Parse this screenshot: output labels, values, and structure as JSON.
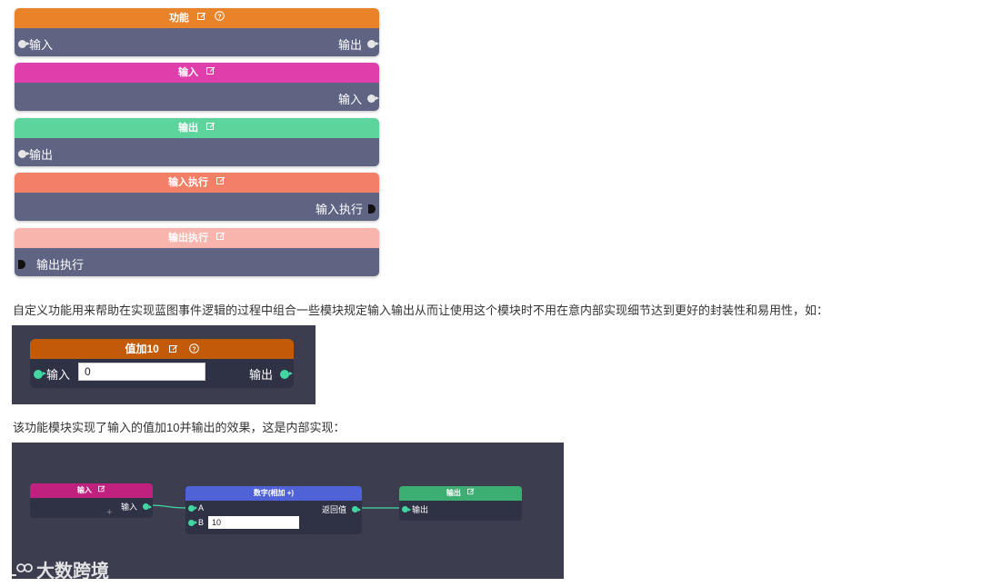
{
  "nodes": {
    "function": {
      "title": "功能",
      "input": "输入",
      "output": "输出",
      "color": "#e8832a"
    },
    "input": {
      "title": "输入",
      "output": "输入",
      "color": "#e03fab"
    },
    "output": {
      "title": "输出",
      "input": "输出",
      "color": "#5cd49c"
    },
    "input_exec": {
      "title": "输入执行",
      "output": "输入执行",
      "color": "#f37f66"
    },
    "output_exec": {
      "title": "输出执行",
      "input": "输出执行",
      "color": "#f8b5ae"
    }
  },
  "text": {
    "description": "自定义功能用来帮助在实现蓝图事件逻辑的过程中组合一些模块规定输入输出从而让使用这个模块时不用在意内部实现细节达到更好的封装性和易用性，如：",
    "explanation": "该功能模块实现了输入的值加10并输出的效果，这是内部实现："
  },
  "example1": {
    "title": "值加10",
    "input_label": "输入",
    "input_value": "0",
    "output_label": "输出",
    "color": "#c25b08"
  },
  "example2": {
    "input_node": {
      "title": "输入",
      "pin": "输入",
      "color": "#c0207e"
    },
    "add_node": {
      "title": "数字(相加 +)",
      "pin_a": "A",
      "pin_b": "B",
      "b_value": "10",
      "return": "返回值",
      "color": "#4f63d6"
    },
    "output_node": {
      "title": "输出",
      "pin": "输出",
      "color": "#3dae72"
    }
  },
  "watermark": {
    "text": "大数跨境"
  }
}
